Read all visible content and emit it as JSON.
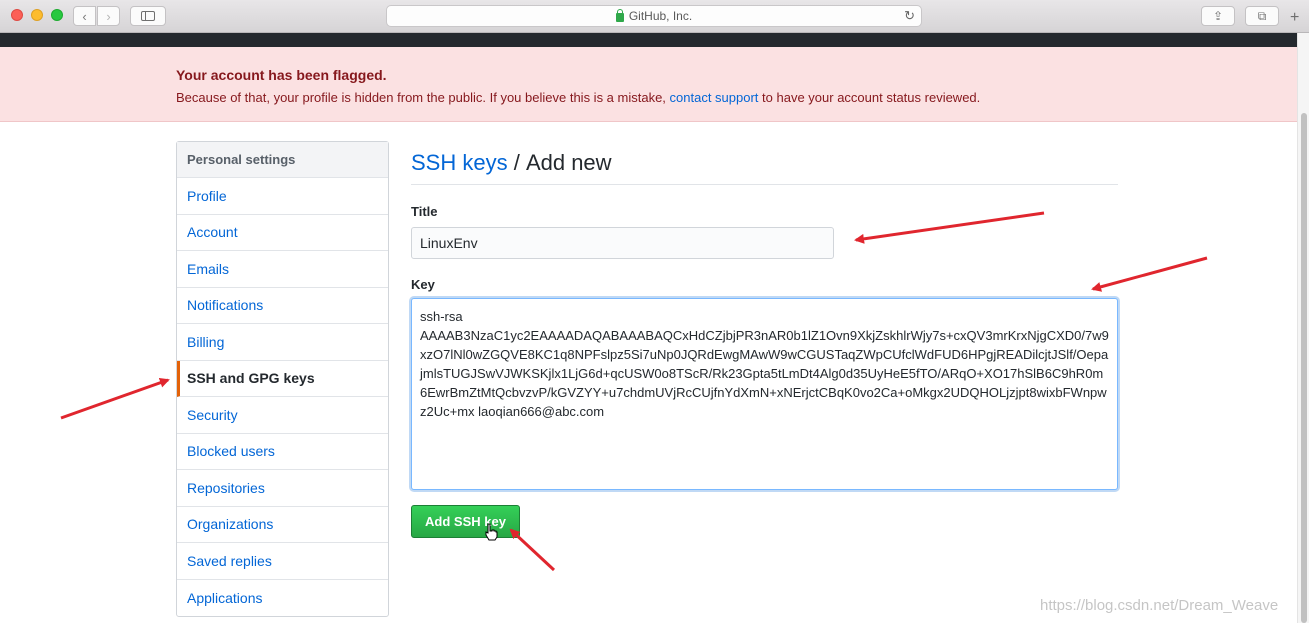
{
  "browser": {
    "address_text": "GitHub, Inc.",
    "back_glyph": "‹",
    "forward_glyph": "›",
    "reload_glyph": "↻",
    "share_glyph": "⇪",
    "tabs_glyph": "⧉",
    "newtab_glyph": "+"
  },
  "flash": {
    "title": "Your account has been flagged.",
    "message_before": "Because of that, your profile is hidden from the public. If you believe this is a mistake, ",
    "link": "contact support",
    "message_after": " to have your account status reviewed."
  },
  "menu": {
    "heading": "Personal settings",
    "items": [
      {
        "label": "Profile"
      },
      {
        "label": "Account"
      },
      {
        "label": "Emails"
      },
      {
        "label": "Notifications"
      },
      {
        "label": "Billing"
      },
      {
        "label": "SSH and GPG keys",
        "selected": true
      },
      {
        "label": "Security"
      },
      {
        "label": "Blocked users"
      },
      {
        "label": "Repositories"
      },
      {
        "label": "Organizations"
      },
      {
        "label": "Saved replies"
      },
      {
        "label": "Applications"
      }
    ]
  },
  "main": {
    "breadcrumb_link": "SSH keys",
    "breadcrumb_sep": " / ",
    "breadcrumb_current": "Add new",
    "title_label": "Title",
    "title_value": "LinuxEnv",
    "key_label": "Key",
    "key_value": "ssh-rsa\nAAAAB3NzaC1yc2EAAAADAQABAAABAQCxHdCZjbjPR3nAR0b1lZ1Ovn9XkjZskhlrWjy7s+cxQV3mrKrxNjgCXD0/7w9xzO7lNl0wZGQVE8KC1q8NPFslpz5Si7uNp0JQRdEwgMAwW9wCGUSTaqZWpCUfclWdFUD6HPgjREADilcjtJSlf/OepajmlsTUGJSwVJWKSKjlx1LjG6d+qcUSW0o8TScR/Rk23Gpta5tLmDt4Alg0d35UyHeE5fTO/ARqO+XO17hSlB6C9hR0m6EwrBmZtMtQcbvzvP/kGVZYY+u7chdmUVjRcCUjfnYdXmN+xNErjctCBqK0vo2Ca+oMkgx2UDQHOLjzjpt8wixbFWnpwz2Uc+mx laoqian666@abc.com",
    "submit_label": "Add SSH key"
  },
  "watermark": "https://blog.csdn.net/Dream_Weave",
  "colors": {
    "annotation_arrow": "#e0262e",
    "flash_bg": "#fbe1e2",
    "link": "#0366d6",
    "button_green": "#28a745",
    "selected_accent": "#e36209"
  }
}
